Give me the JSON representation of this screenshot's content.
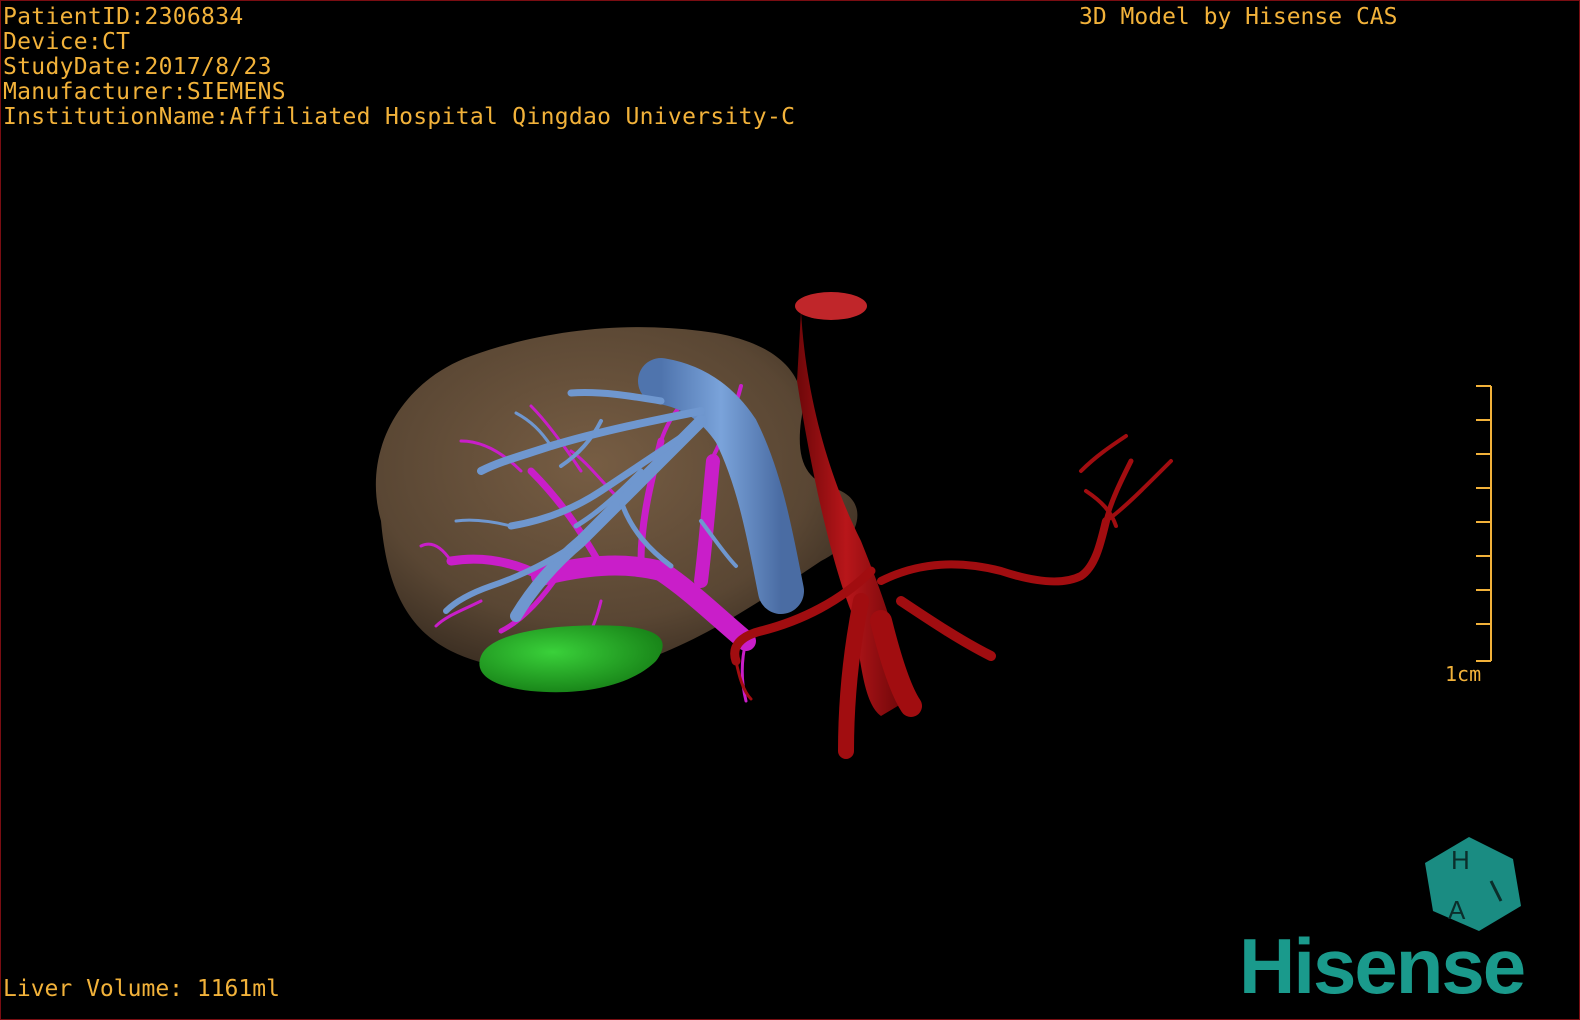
{
  "overlay": {
    "patient_id": "PatientID:2306834",
    "device": "Device:CT",
    "study_date": "StudyDate:2017/8/23",
    "manufacturer": "Manufacturer:SIEMENS",
    "institution": "InstitutionName:Affiliated Hospital Qingdao University-C"
  },
  "credit": "3D Model by Hisense CAS",
  "liver_volume": "Liver Volume: 1161ml",
  "scale_bar": {
    "label": "1cm",
    "ticks": 9
  },
  "logo": {
    "badge_letters": "HA",
    "brand": "Hisense",
    "icon": "hisense-cube-icon"
  },
  "colors": {
    "overlay_text": "#f2b23a",
    "liver": "#6b5440",
    "hepatic_vein": "#6f97cf",
    "portal_vein": "#c91ec9",
    "artery_aorta": "#a10d10",
    "gallbladder": "#1fa31f",
    "brand": "#1a9a8c"
  }
}
